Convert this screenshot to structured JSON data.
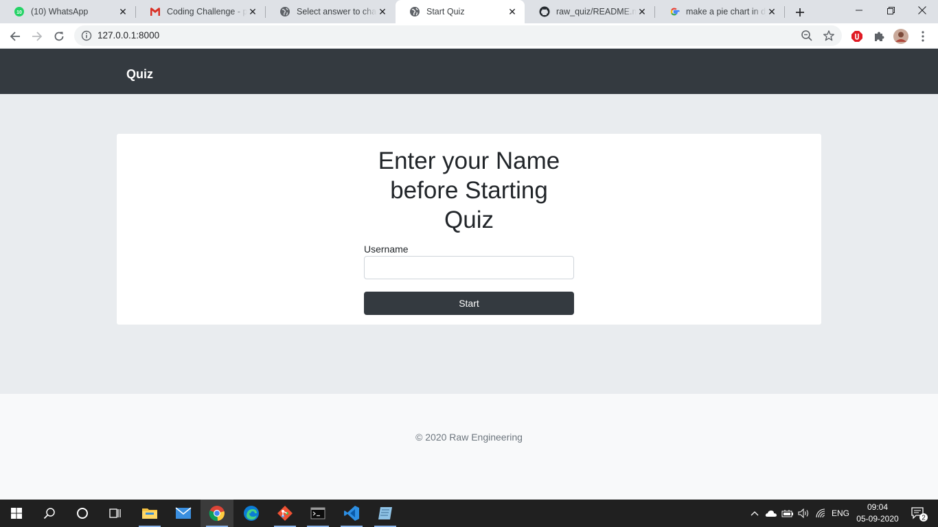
{
  "browser": {
    "tabs": [
      {
        "title": "(10) WhatsApp",
        "icon": "whatsapp-icon",
        "active": false
      },
      {
        "title": "Coding Challenge - pav",
        "icon": "gmail-icon",
        "active": false
      },
      {
        "title": "Select answer to change",
        "icon": "globe-icon",
        "active": false
      },
      {
        "title": "Start Quiz",
        "icon": "globe-icon",
        "active": true
      },
      {
        "title": "raw_quiz/README.md a",
        "icon": "github-icon",
        "active": false
      },
      {
        "title": "make a pie chart in djan",
        "icon": "google-icon",
        "active": false
      }
    ],
    "whatsapp_badge": "10",
    "url": "127.0.0.1:8000"
  },
  "navbar": {
    "brand": "Quiz"
  },
  "form": {
    "heading": "Enter your Name before Starting Quiz",
    "username_label": "Username",
    "username_value": "",
    "start_label": "Start"
  },
  "footer": {
    "text": "© 2020 Raw Engineering"
  },
  "taskbar": {
    "language": "ENG",
    "time": "09:04",
    "date": "05-09-2020",
    "notification_count": "2"
  },
  "colors": {
    "navbar": "#343a40",
    "page_bg": "#e9ecef",
    "button": "#343a40",
    "footer_bg": "#f8f9fa"
  }
}
